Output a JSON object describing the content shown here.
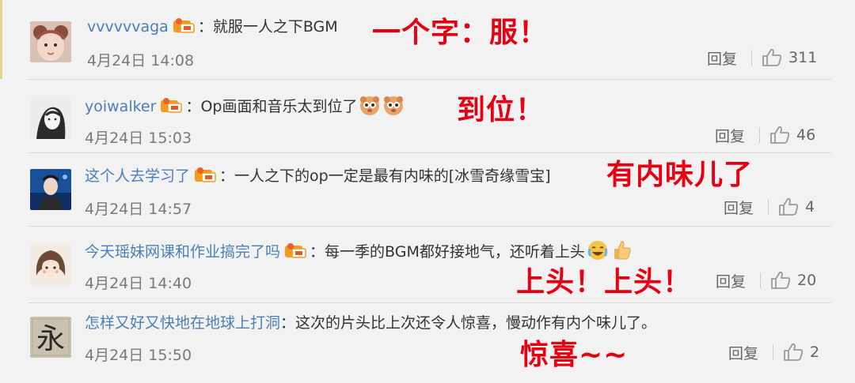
{
  "comments": [
    {
      "username": "vvvvvvaga",
      "colon": "：",
      "text": "就服一人之下BGM",
      "date": "4月24日 14:08",
      "reply": "回复",
      "likes": "311",
      "annotation": "一个字：服！"
    },
    {
      "username": "yoiwalker",
      "colon": "：",
      "text": "Op画面和音乐太到位了",
      "date": "4月24日 15:03",
      "reply": "回复",
      "likes": "46",
      "annotation": "到位！"
    },
    {
      "username": "这个人去学习了",
      "colon": "：",
      "text": "一人之下的op一定是最有内味的[冰雪奇缘雪宝]",
      "date": "4月24日 14:57",
      "reply": "回复",
      "likes": "4",
      "annotation": "有内味儿了"
    },
    {
      "username": "今天瑶妹网课和作业搞完了吗",
      "colon": "：",
      "text": "每一季的BGM都好接地气，还听着上头",
      "date": "4月24日 14:40",
      "reply": "回复",
      "likes": "20",
      "annotation": "上头！上头！"
    },
    {
      "username": "怎样又好又快地在地球上打洞",
      "colon": "：",
      "text": "这次的片头比上次还令人惊喜，慢动作有内个味儿了。",
      "date": "4月24日 15:50",
      "reply": "回复",
      "likes": "2",
      "annotation": "惊喜~~",
      "avatar_glyph": "永"
    }
  ],
  "colors": {
    "username": "#4a7fb8",
    "annotation": "#e60012",
    "background": "#f2f2f2"
  },
  "icons": [
    "vip-badge-icon",
    "thumbs-up-icon",
    "doge-emoji-icon",
    "laugh-cry-emoji-icon"
  ]
}
